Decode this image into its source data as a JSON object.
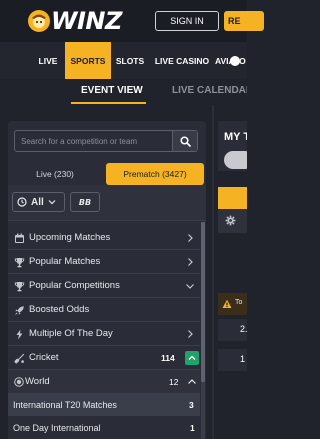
{
  "header": {
    "logo_text": "WINZ",
    "signin_label": "SIGN IN",
    "register_label": "RE"
  },
  "nav": {
    "items": [
      "LIVE",
      "SPORTS",
      "SLOTS",
      "LIVE CASINO",
      "AVIATO"
    ],
    "active": "SPORTS"
  },
  "subnav": {
    "items": [
      "EVENT VIEW",
      "LIVE CALENDAR"
    ],
    "active": "EVENT VIEW"
  },
  "search": {
    "placeholder": "Search for a competition or team"
  },
  "tabs": {
    "live_label": "Live (230)",
    "prematch_label": "Prematch (3427)"
  },
  "filters": {
    "time_value": "All",
    "bb_label": "BB"
  },
  "menu": [
    {
      "label": "Upcoming Matches",
      "icon": "calendar-icon"
    },
    {
      "label": "Popular Matches",
      "icon": "trophy-icon"
    },
    {
      "label": "Popular Competitions",
      "icon": "trophy-icon"
    },
    {
      "label": "Boosted Odds",
      "icon": "rocket-icon"
    },
    {
      "label": "Multiple Of The Day",
      "icon": "bolt-icon"
    }
  ],
  "sport": {
    "label": "Cricket",
    "count": "114",
    "icon": "cricket-bat-icon"
  },
  "region": {
    "label": "World",
    "count": "12",
    "icon": "globe-icon"
  },
  "competitions": [
    {
      "label": "International T20 Matches",
      "count": "3"
    },
    {
      "label": "One Day International",
      "count": "1"
    }
  ],
  "right_pane": {
    "title_fragment": "MY T",
    "badge_fragment": "To",
    "value_1": "2.",
    "value_2": "1"
  },
  "colors": {
    "accent": "#f5b323",
    "background": "#20232c",
    "panel": "#2a2d37",
    "green": "#1fa36b"
  }
}
